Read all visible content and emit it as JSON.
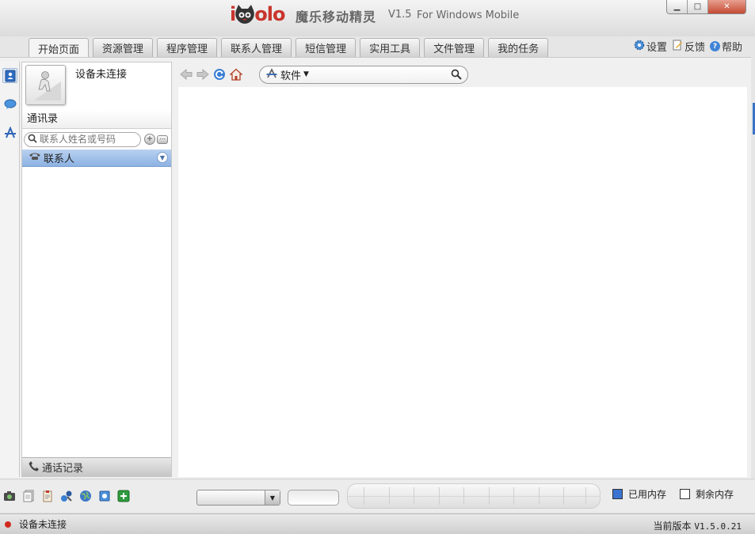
{
  "window": {
    "logo_text_left": "i",
    "logo_text_right": "olo",
    "app_name": "魔乐移动精灵",
    "version": "V1.5",
    "platform": "For Windows Mobile",
    "controls": {
      "minimize": "▁",
      "maximize": "□",
      "close": "✕"
    }
  },
  "tabs": [
    {
      "label": "开始页面",
      "active": true
    },
    {
      "label": "资源管理"
    },
    {
      "label": "程序管理"
    },
    {
      "label": "联系人管理"
    },
    {
      "label": "短信管理"
    },
    {
      "label": "实用工具"
    },
    {
      "label": "文件管理"
    },
    {
      "label": "我的任务"
    }
  ],
  "top_actions": {
    "settings": "设置",
    "feedback": "反馈",
    "help": "帮助"
  },
  "sidebar_icons": [
    "contacts-book-icon",
    "message-bubble-icon",
    "appstore-icon"
  ],
  "contacts_panel": {
    "device_status": "设备未连接",
    "section_title": "通讯录",
    "search_placeholder": "联系人姓名或号码",
    "group_label": "联系人",
    "call_log_label": "通话记录"
  },
  "browser": {
    "address_label": "软件"
  },
  "bottom_bar": {
    "legend_used": "已用内存",
    "legend_free": "剩余内存",
    "used_color": "#3a73d1",
    "free_color": "#ffffff"
  },
  "status_bar": {
    "connection": "设备未连接",
    "version_label": "当前版本",
    "version_value": "V1.5.0.21"
  }
}
